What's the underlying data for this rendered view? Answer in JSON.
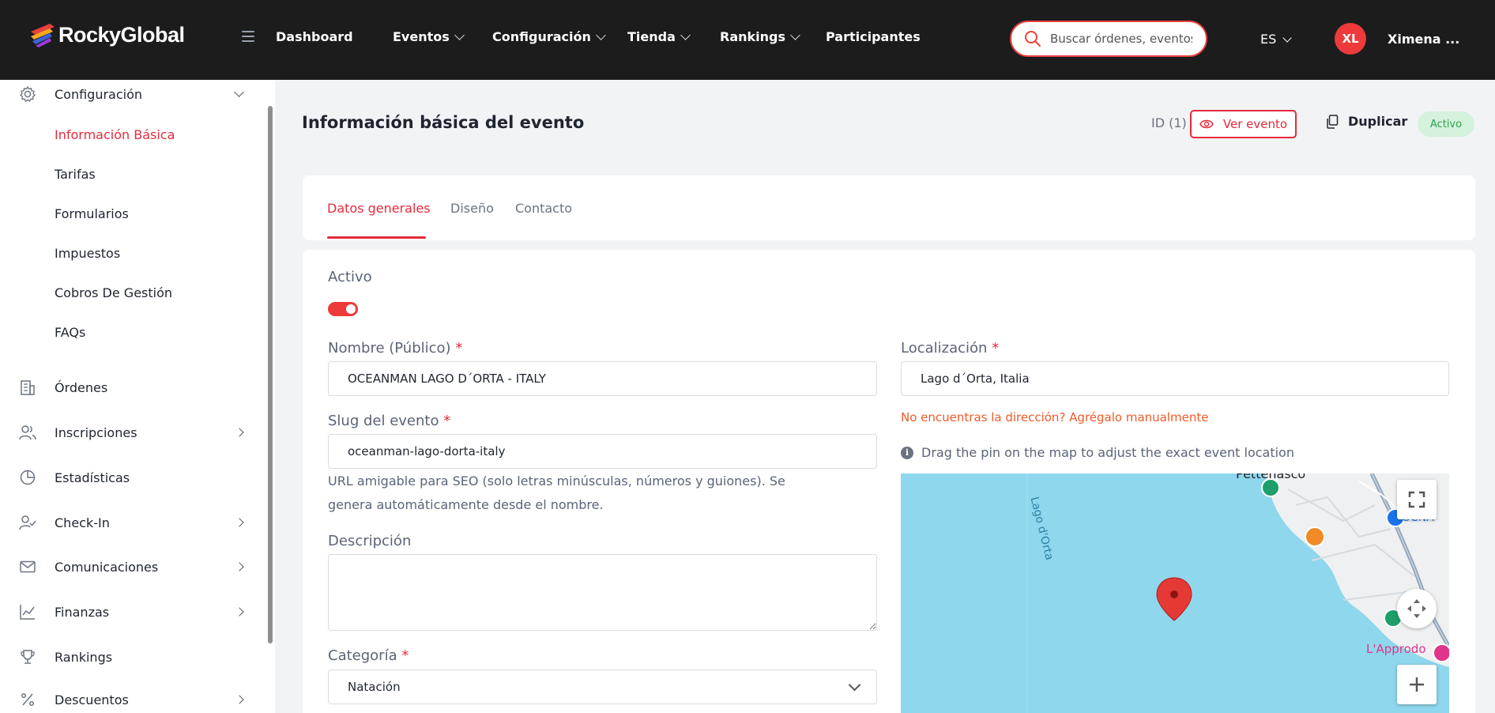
{
  "header": {
    "brand": "RockyGlobal",
    "nav": [
      {
        "label": "Dashboard",
        "has_menu": false
      },
      {
        "label": "Eventos",
        "has_menu": true
      },
      {
        "label": "Configuración",
        "has_menu": true
      },
      {
        "label": "Tienda",
        "has_menu": true
      },
      {
        "label": "Rankings",
        "has_menu": true
      },
      {
        "label": "Participantes",
        "has_menu": false
      }
    ],
    "search_placeholder": "Buscar órdenes, eventos",
    "language": "ES",
    "avatar_initials": "XL",
    "user_name": "Ximena ..."
  },
  "sidebar": {
    "config_label": "Configuración",
    "sub_items": [
      {
        "label": "Información Básica",
        "active": true
      },
      {
        "label": "Tarifas",
        "active": false
      },
      {
        "label": "Formularios",
        "active": false
      },
      {
        "label": "Impuestos",
        "active": false
      },
      {
        "label": "Cobros De Gestión",
        "active": false
      },
      {
        "label": "FAQs",
        "active": false
      }
    ],
    "items": [
      {
        "label": "Órdenes",
        "icon": "building-icon",
        "expandable": false
      },
      {
        "label": "Inscripciones",
        "icon": "users-icon",
        "expandable": true
      },
      {
        "label": "Estadísticas",
        "icon": "pie-chart-icon",
        "expandable": false
      },
      {
        "label": "Check-In",
        "icon": "user-check-icon",
        "expandable": true
      },
      {
        "label": "Comunicaciones",
        "icon": "mail-icon",
        "expandable": true
      },
      {
        "label": "Finanzas",
        "icon": "line-chart-icon",
        "expandable": true
      },
      {
        "label": "Rankings",
        "icon": "trophy-icon",
        "expandable": false
      },
      {
        "label": "Descuentos",
        "icon": "percent-icon",
        "expandable": true
      }
    ]
  },
  "page": {
    "title": "Información básica del evento",
    "id_label": "ID (1)",
    "view_button": "Ver evento",
    "duplicate_button": "Duplicar",
    "status_badge": "Activo"
  },
  "tabs": [
    {
      "label": "Datos generales",
      "active": true
    },
    {
      "label": "Diseño",
      "active": false
    },
    {
      "label": "Contacto",
      "active": false
    }
  ],
  "form": {
    "active_label": "Activo",
    "active_value": true,
    "name_label": "Nombre (Público)",
    "name_value": "OCEANMAN LAGO D´ORTA - ITALY",
    "slug_label": "Slug del evento",
    "slug_value": "oceanman-lago-dorta-italy",
    "slug_help": "URL amigable para SEO (solo letras minúsculas, números y guiones). Se genera automáticamente desde el nombre.",
    "description_label": "Descripción",
    "description_value": "",
    "category_label": "Categoría",
    "category_value": "Natación",
    "location_label": "Localización",
    "location_value": "Lago d´Orta, Italia",
    "address_link": "No encuentras la dirección? Agrégalo manualmente",
    "pin_hint": "Drag the pin on the map to adjust the exact event location",
    "required_mark": "*"
  },
  "map": {
    "water_label": "Lago d'Orta",
    "town_label": "Pettenasco",
    "poi_label": "L'Approdo",
    "partial_label": "OCNA",
    "water_color": "#8fd7ec",
    "land_color": "#eef0f1",
    "pin_color": "#e53935"
  },
  "colors": {
    "accent": "#e42b3c",
    "topbar": "#1c1c1c",
    "badge_bg": "#d4f2dc",
    "badge_text": "#2fa04b"
  }
}
